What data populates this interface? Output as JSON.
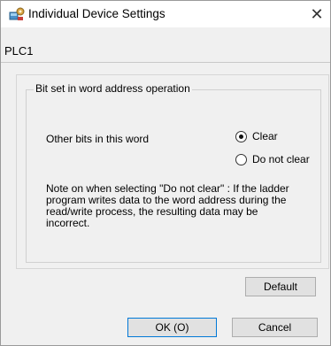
{
  "window": {
    "title": "Individual Device Settings",
    "close_label": "✕",
    "icon": "device-settings-icon"
  },
  "device": {
    "name": "PLC1"
  },
  "group": {
    "legend": "Bit set in word address operation",
    "other_bits_label": "Other bits in this word",
    "options": [
      {
        "label": "Clear",
        "selected": true
      },
      {
        "label": "Do not clear",
        "selected": false
      }
    ],
    "note": "Note on when selecting \"Do not clear\" : If the ladder program writes data to the word address during the read/write process, the resulting data may be incorrect."
  },
  "buttons": {
    "default_label": "Default",
    "ok_label": "OK (O)",
    "cancel_label": "Cancel"
  },
  "colors": {
    "accent": "#0078d7",
    "background": "#f0f0f0"
  }
}
